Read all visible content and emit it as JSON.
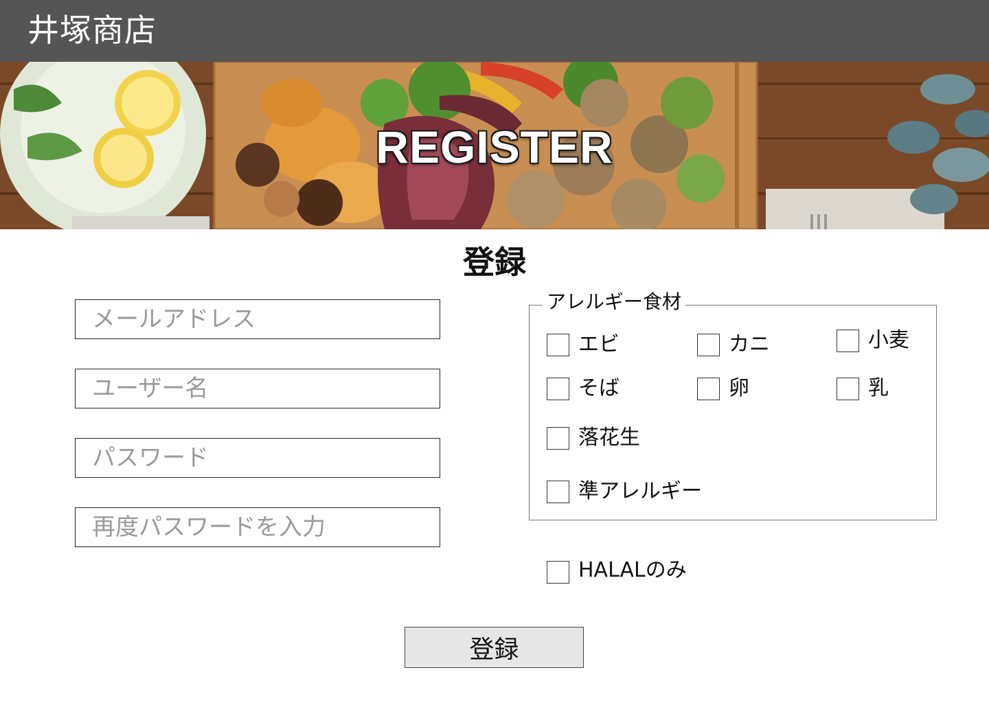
{
  "header": {
    "shop_name": "井塚商店"
  },
  "hero": {
    "title": "REGISTER"
  },
  "form": {
    "title": "登録",
    "email_placeholder": "メールアドレス",
    "username_placeholder": "ユーザー名",
    "password_placeholder": "パスワード",
    "password_confirm_placeholder": "再度パスワードを入力",
    "submit_label": "登録"
  },
  "allergy": {
    "legend": "アレルギー食材",
    "items": [
      "エビ",
      "カニ",
      "小麦",
      "そば",
      "卵",
      "乳",
      "落花生",
      "準アレルギー"
    ]
  },
  "halal": {
    "label": "HALALのみ"
  }
}
